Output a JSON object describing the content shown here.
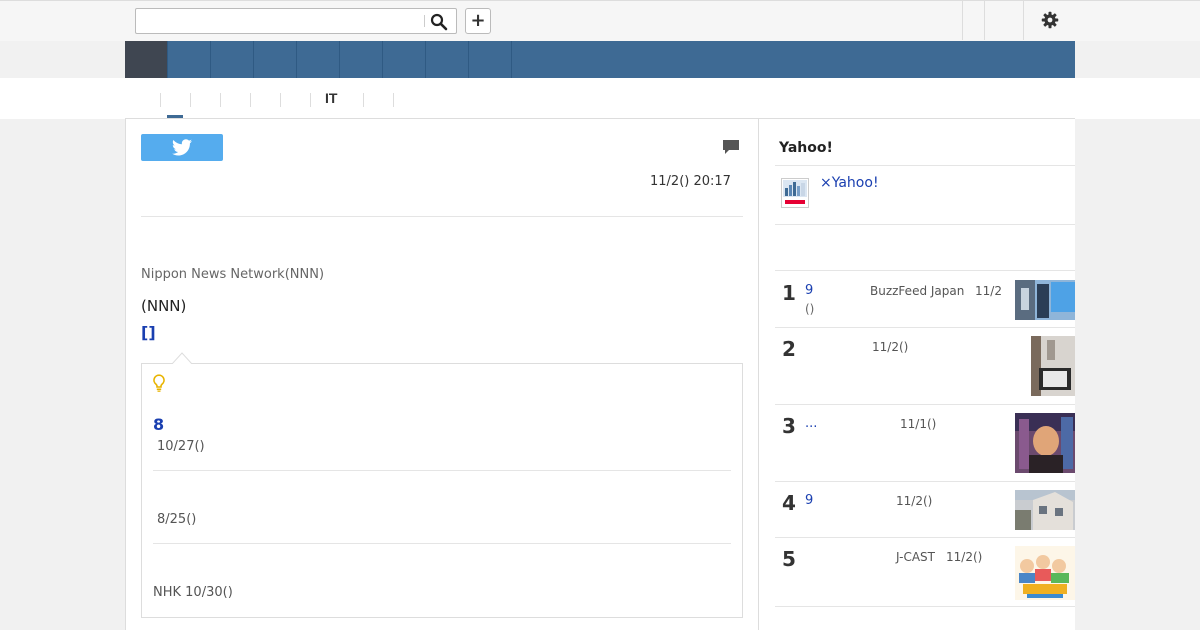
{
  "search": {
    "value": "",
    "placeholder": ""
  },
  "header": {
    "plus_label": "+"
  },
  "subnav": {
    "it_label": "IT"
  },
  "article": {
    "date": "11/2() 20:17",
    "source": "Nippon News Network(NNN)",
    "nnn_text": "(NNN)",
    "bracket_link": "[]"
  },
  "related": {
    "title_link": "8",
    "items": [
      {
        "date": "10/27()"
      },
      {
        "date": "8/25()"
      },
      {
        "date": "NHK 10/30()"
      }
    ]
  },
  "sidebar": {
    "title": "Yahoo!",
    "yahoo_link": "×Yahoo!",
    "ranking": [
      {
        "rank": "1",
        "title": "9",
        "sub": "()",
        "source": "BuzzFeed Japan",
        "date": "11/2"
      },
      {
        "rank": "2",
        "title": "",
        "sub": "",
        "source": "",
        "date": "11/2()"
      },
      {
        "rank": "3",
        "title": "...",
        "sub": "",
        "source": "",
        "date": "11/1()"
      },
      {
        "rank": "4",
        "title": "9",
        "sub": "",
        "source": "",
        "date": "11/2()"
      },
      {
        "rank": "5",
        "title": "",
        "sub": "",
        "source": "J-CAST",
        "date": "11/2()"
      }
    ]
  },
  "colors": {
    "nav_blue": "#3e6a94",
    "nav_active": "#3f4651",
    "link_blue": "#1a3fb0",
    "twitter_blue": "#55acee"
  },
  "icons": [
    "search-icon",
    "plus-icon",
    "gear-icon",
    "twitter-icon",
    "comment-icon",
    "bulb-icon",
    "yahoo-logo"
  ]
}
